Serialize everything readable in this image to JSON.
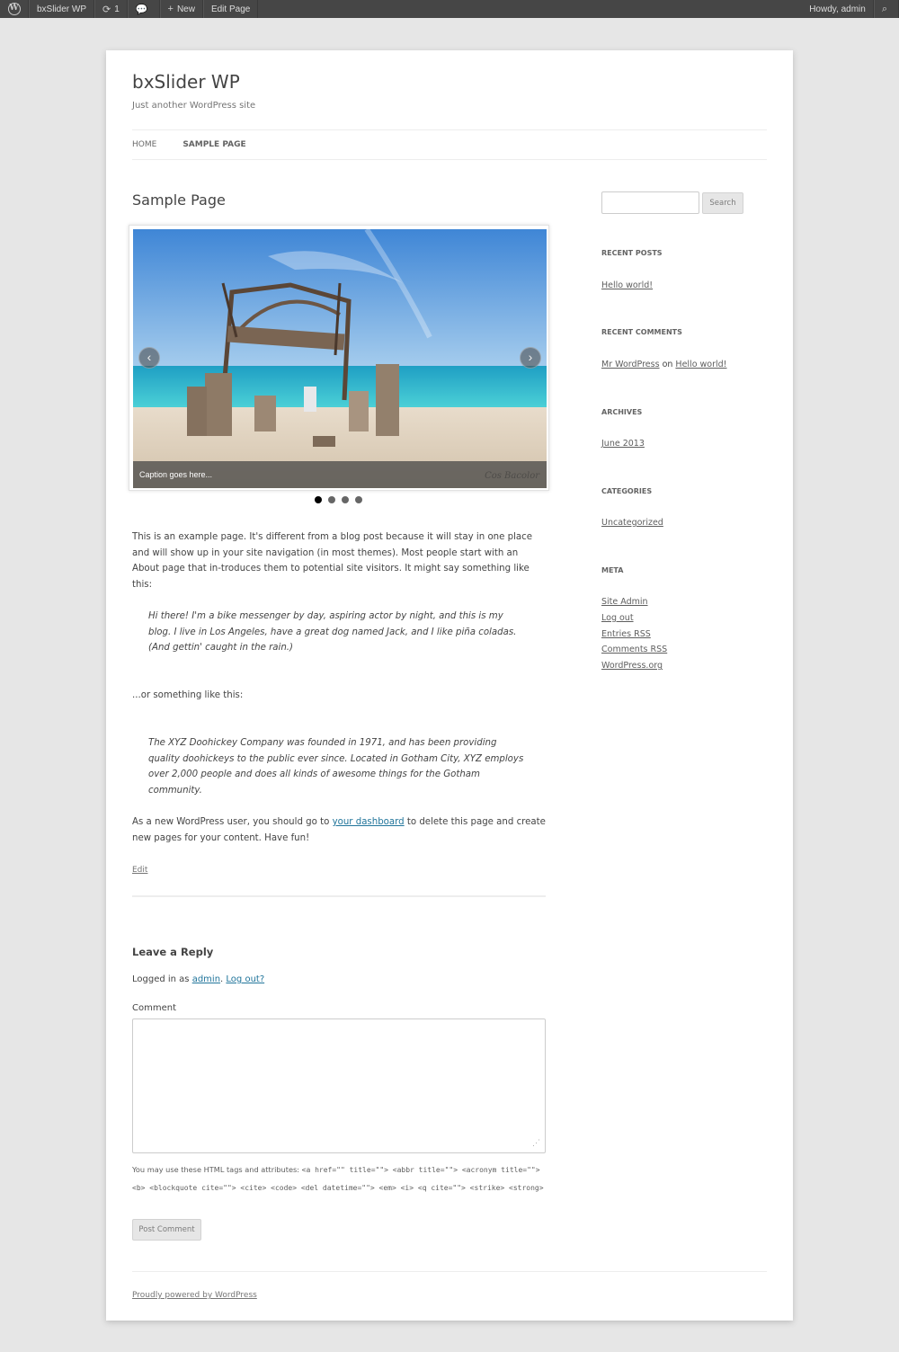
{
  "adminbar": {
    "site_name": "bxSlider WP",
    "updates_count": "1",
    "new_label": "New",
    "edit_label": "Edit Page",
    "howdy": "Howdy, admin"
  },
  "site": {
    "title": "bxSlider WP",
    "description": "Just another WordPress site"
  },
  "nav": {
    "items": [
      {
        "label": "HOME"
      },
      {
        "label": "SAMPLE PAGE"
      }
    ]
  },
  "page": {
    "title": "Sample Page",
    "slider": {
      "caption": "Caption goes here...",
      "watermark": "Cos Bacolor",
      "pager_count": 4,
      "active_index": 0
    },
    "paragraph1": "This is an example page. It's different from a blog post because it will stay in one place and will show up in your site navigation (in most themes). Most people start with an About page that in-troduces them to potential site visitors. It might say something like this:",
    "quote1": "Hi there! I'm a bike messenger by day, aspiring actor by night, and this is my blog. I live in Los Angeles, have a great dog named Jack, and I like piña coladas. (And gettin' caught in the rain.)",
    "paragraph2": "...or something like this:",
    "quote2": "The XYZ Doohickey Company was founded in 1971, and has been providing quality doohickeys to the public ever since. Located in Gotham City, XYZ employs over 2,000 people and does all kinds of awesome things for the Gotham community.",
    "paragraph3_before": "As a new WordPress user, you should go to ",
    "paragraph3_link": "your dashboard",
    "paragraph3_after": " to delete this page and create new pages for your content. Have fun!",
    "edit_link": "Edit"
  },
  "comments": {
    "reply_title": "Leave a Reply",
    "logged_in_prefix": "Logged in as ",
    "user_link": "admin",
    "separator": ". ",
    "logout_link": "Log out?",
    "comment_label": "Comment",
    "allowed_prefix": "You may use these HTML tags and attributes: ",
    "allowed_tags": "<a href=\"\" title=\"\"> <abbr title=\"\"> <acronym title=\"\"> <b> <blockquote cite=\"\"> <cite> <code> <del datetime=\"\"> <em> <i> <q cite=\"\"> <strike> <strong>",
    "submit_label": "Post Comment"
  },
  "footer": {
    "credit": "Proudly powered by WordPress"
  },
  "sidebar": {
    "search_button": "Search",
    "search_value": "",
    "recent_posts": {
      "title": "RECENT POSTS",
      "items": [
        "Hello world!"
      ]
    },
    "recent_comments": {
      "title": "RECENT COMMENTS",
      "author": "Mr WordPress",
      "on": " on ",
      "post": "Hello world!"
    },
    "archives": {
      "title": "ARCHIVES",
      "items": [
        "June 2013"
      ]
    },
    "categories": {
      "title": "CATEGORIES",
      "items": [
        "Uncategorized"
      ]
    },
    "meta": {
      "title": "META",
      "items": [
        "Site Admin",
        "Log out",
        "Entries RSS",
        "Comments RSS",
        "WordPress.org"
      ]
    }
  },
  "colors": {
    "adminbar_bg": "#464646",
    "link_blue": "#21759b",
    "page_bg": "#e6e6e6"
  }
}
